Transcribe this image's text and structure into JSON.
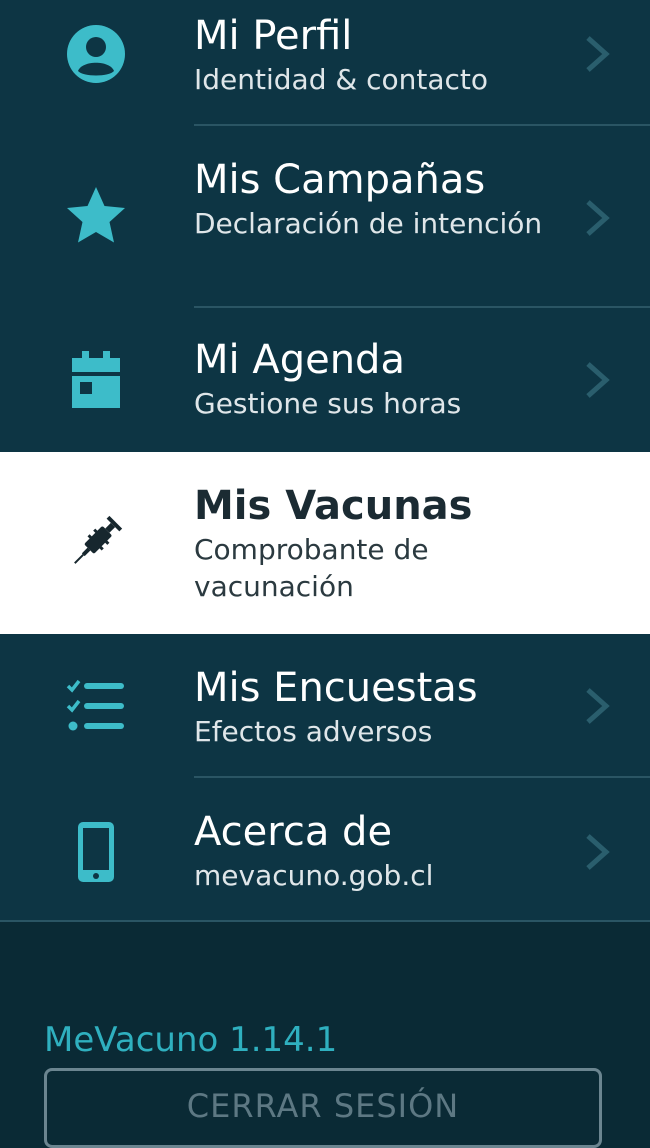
{
  "colors": {
    "menu_background": "#0d3544",
    "footer_background": "#0a2a35",
    "icon_teal": "#3dbcc9",
    "active_background": "#ffffff",
    "divider": "#2a5564",
    "version_text": "#2fb0bf"
  },
  "menu": {
    "items": [
      {
        "title": "Mi Perfil",
        "subtitle": "Identidad & contacto",
        "icon": "user-circle-icon",
        "active": false
      },
      {
        "title": "Mis Campañas",
        "subtitle": "Declaración de intención",
        "icon": "star-icon",
        "active": false
      },
      {
        "title": "Mi Agenda",
        "subtitle": "Gestione sus horas",
        "icon": "calendar-icon",
        "active": false
      },
      {
        "title": "Mis Vacunas",
        "subtitle": "Comprobante de vacunación",
        "icon": "syringe-icon",
        "active": true
      },
      {
        "title": "Mis Encuestas",
        "subtitle": "Efectos adversos",
        "icon": "checklist-icon",
        "active": false
      },
      {
        "title": "Acerca de",
        "subtitle": "mevacuno.gob.cl",
        "icon": "smartphone-icon",
        "active": false
      }
    ]
  },
  "footer": {
    "version": "MeVacuno 1.14.1",
    "logout_label": "CERRAR SESIÓN"
  }
}
